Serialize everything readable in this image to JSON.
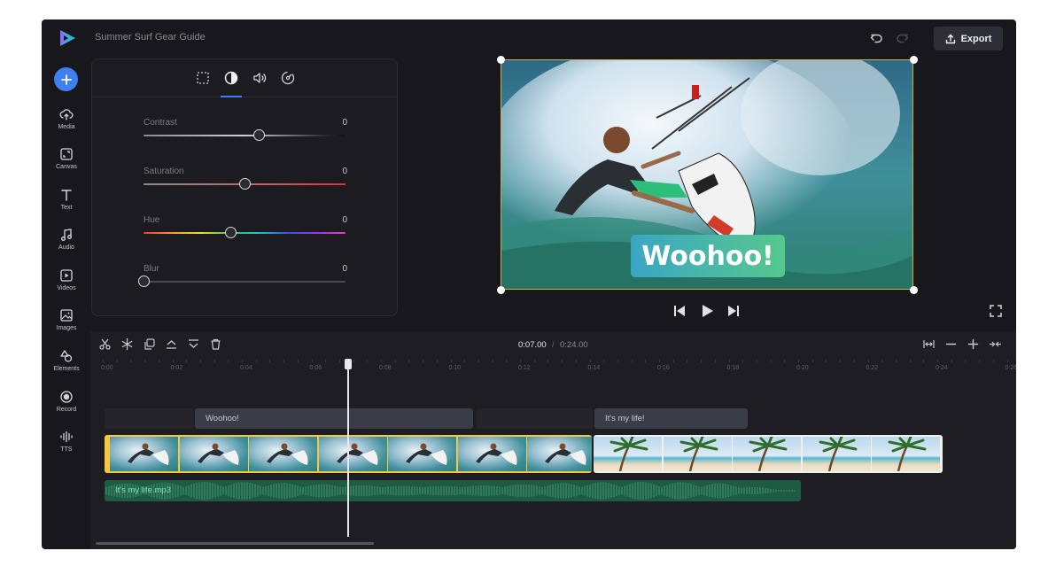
{
  "app": {
    "project_title": "Summer Surf Gear Guide",
    "export_label": "Export"
  },
  "sidebar": {
    "items": [
      {
        "label": "Media",
        "icon": "cloud-upload-icon"
      },
      {
        "label": "Canvas",
        "icon": "canvas-icon"
      },
      {
        "label": "Text",
        "icon": "text-icon"
      },
      {
        "label": "Audio",
        "icon": "music-note-icon"
      },
      {
        "label": "Videos",
        "icon": "play-box-icon"
      },
      {
        "label": "Images",
        "icon": "image-icon"
      },
      {
        "label": "Elements",
        "icon": "shapes-icon"
      },
      {
        "label": "Record",
        "icon": "record-icon"
      },
      {
        "label": "TTS",
        "icon": "waveform-icon"
      }
    ]
  },
  "adjust_panel": {
    "tabs": [
      "crop-icon",
      "contrast-icon",
      "volume-icon",
      "speed-icon"
    ],
    "active_tab": 1,
    "sliders": [
      {
        "name": "Contrast",
        "value": "0",
        "level": 0.57
      },
      {
        "name": "Saturation",
        "value": "0",
        "level": 0.5
      },
      {
        "name": "Hue",
        "value": "0",
        "level": 0.43
      },
      {
        "name": "Blur",
        "value": "0",
        "level": 0.0
      }
    ]
  },
  "preview": {
    "caption": "Woohoo!"
  },
  "timeline": {
    "current_time": "0:07.00",
    "separator": "/",
    "total_time": "0:24.00",
    "ruler_labels": [
      "0:00",
      "0:02",
      "0:04",
      "0:06",
      "0:08",
      "0:10",
      "0:12",
      "0:14",
      "0:16",
      "0:18",
      "0:20",
      "0:22",
      "0:24",
      "0:26"
    ],
    "text_clips": [
      {
        "label": "Woohoo!"
      },
      {
        "label": "It's my life!"
      }
    ],
    "audio_clip": "It's my life.mp3"
  },
  "colors": {
    "accent": "#3f7ff2",
    "selection": "#f5c842",
    "audio": "#1f5a45",
    "background": "#18181c"
  }
}
